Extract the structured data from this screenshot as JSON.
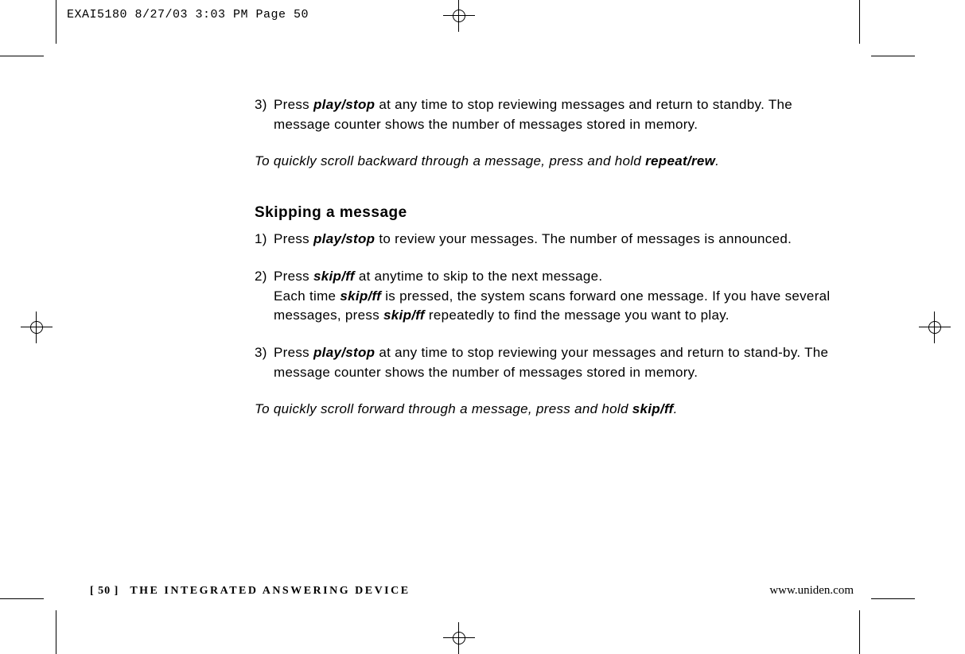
{
  "slug": "EXAI5180  8/27/03 3:03 PM  Page 50",
  "intro_step": {
    "num": "3)",
    "pre": "Press ",
    "btn": "play/stop",
    "post": " at any time to stop reviewing messages and return to standby. The message counter shows the number of messages stored in memory."
  },
  "intro_note_pre": "To quickly scroll backward through a message, press and hold ",
  "intro_note_btn": "repeat/rew",
  "intro_note_post": ".",
  "section_heading": "Skipping a message",
  "step1": {
    "num": "1)",
    "pre": "Press ",
    "btn": "play/stop",
    "post": " to review your messages. The number of messages is announced."
  },
  "step2": {
    "num": "2)",
    "l1_pre": "Press ",
    "l1_btn": "skip/ff",
    "l1_post": " at anytime to skip to the next message.",
    "l2_pre": "Each time ",
    "l2_btn": "skip/ff",
    "l2_mid": " is pressed, the system scans forward one message. If you have several messages, press ",
    "l2_btn2": "skip/ff",
    "l2_post": " repeatedly to find the message you want to play."
  },
  "step3": {
    "num": "3)",
    "pre": "Press ",
    "btn": "play/stop",
    "post": " at any time to stop reviewing your messages and return to stand‑by. The message counter shows the number of messages stored in memory."
  },
  "end_note_pre": "To quickly scroll forward through a message, press and hold ",
  "end_note_btn": "skip/ff",
  "end_note_post": ".",
  "footer": {
    "page": "[ 50 ]",
    "title": "THE INTEGRATED ANSWERING DEVICE",
    "url": "www.uniden.com"
  }
}
